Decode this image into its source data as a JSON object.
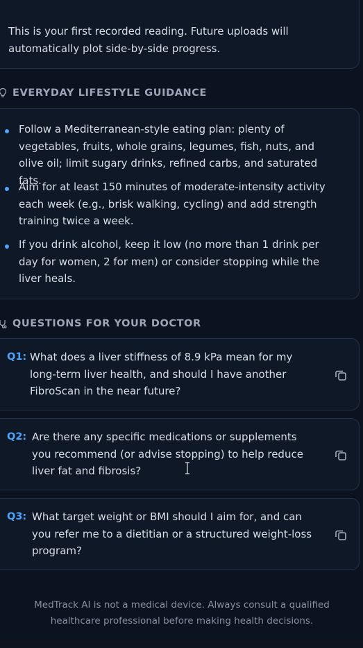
{
  "intro": {
    "text": "This is your first recorded reading. Future uploads will automatically plot side-by-side progress."
  },
  "lifestyle": {
    "title": "EVERYDAY LIFESTYLE GUIDANCE",
    "items": [
      {
        "text": "Follow a Mediterranean-style eating plan: plenty of vegetables, fruits, whole grains, legumes, fish, nuts, and olive oil; limit sugary drinks, refined carbs, and saturated fats."
      },
      {
        "text": "Aim for at least 150 minutes of moderate-intensity activity each week (e.g., brisk walking, cycling) and add strength training twice a week."
      },
      {
        "text": "If you drink alcohol, keep it low (no more than 1 drink per day for women, 2 for men) or consider stopping while the liver heals."
      }
    ]
  },
  "questions": {
    "title": "QUESTIONS FOR YOUR DOCTOR",
    "items": [
      {
        "label": "Q1:",
        "text": "What does a liver stiffness of 8.9 kPa mean for my long-term liver health, and should I have another FibroScan in the near future?"
      },
      {
        "label": "Q2:",
        "text": "Are there any specific medications or supplements you recommend (or advise stopping) to help reduce liver fat and fibrosis?"
      },
      {
        "label": "Q3:",
        "text": "What target weight or BMI should I aim for, and can you refer me to a dietitian or a structured weight-loss program?"
      }
    ]
  },
  "footer": {
    "disclaimer": "MedTrack AI is not a medical device. Always consult a qualified healthcare professional before making health decisions."
  },
  "colors": {
    "accent": "#4ea3ff",
    "background": "#0b1220",
    "card": "#0f1827",
    "border": "#26324a"
  }
}
